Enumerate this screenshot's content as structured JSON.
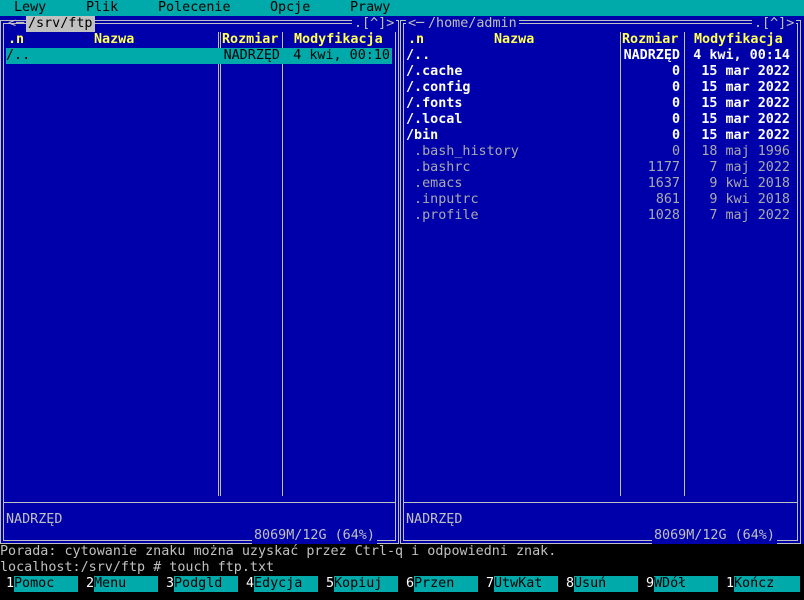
{
  "menubar": [
    "Lewy",
    "Plik",
    "Polecenie",
    "Opcje",
    "Prawy"
  ],
  "left_panel": {
    "path": " /srv/ftp ",
    "corner": ".[^]>",
    "arrows": "<─",
    "columns": [
      ".n",
      "Nazwa",
      "Rozmiar",
      "Modyfikacja"
    ],
    "rows": [
      {
        "name": "/..",
        "size": "NADRZĘD",
        "date": "4 kwi, 00:10",
        "selected": true,
        "type": "dir"
      }
    ],
    "status": "NADRZĘD",
    "free": " 8069M/12G (64%) "
  },
  "right_panel": {
    "path": " /home/admin ",
    "corner": ".[^]>",
    "arrows": "<─",
    "columns": [
      ".n",
      "Nazwa",
      "Rozmiar",
      "Modyfikacja"
    ],
    "rows": [
      {
        "name": "/..",
        "size": "NADRZĘD",
        "date": "4 kwi, 00:14",
        "type": "dir"
      },
      {
        "name": "/.cache",
        "size": "0",
        "date": "15 mar 2022",
        "type": "dir"
      },
      {
        "name": "/.config",
        "size": "0",
        "date": "15 mar 2022",
        "type": "dir"
      },
      {
        "name": "/.fonts",
        "size": "0",
        "date": "15 mar 2022",
        "type": "dir"
      },
      {
        "name": "/.local",
        "size": "0",
        "date": "15 mar 2022",
        "type": "dir"
      },
      {
        "name": "/bin",
        "size": "0",
        "date": "15 mar 2022",
        "type": "dir"
      },
      {
        "name": " .bash_history",
        "size": "0",
        "date": "18 maj 1996",
        "type": "file"
      },
      {
        "name": " .bashrc",
        "size": "1177",
        "date": "7 maj 2022",
        "type": "file"
      },
      {
        "name": " .emacs",
        "size": "1637",
        "date": "9 kwi 2018",
        "type": "file"
      },
      {
        "name": " .inputrc",
        "size": "861",
        "date": "9 kwi 2018",
        "type": "file"
      },
      {
        "name": " .profile",
        "size": "1028",
        "date": "7 maj 2022",
        "type": "file"
      }
    ],
    "status": "NADRZĘD",
    "free": " 8069M/12G (64%) "
  },
  "hint": "Porada: cytowanie znaku można uzyskać przez Ctrl-q i odpowiedni znak.",
  "command_line": "localhost:/srv/ftp # touch ftp.txt",
  "fkeys": [
    {
      "num": "1",
      "label": "Pomoc"
    },
    {
      "num": "2",
      "label": "Menu"
    },
    {
      "num": "3",
      "label": "Podgld"
    },
    {
      "num": "4",
      "label": "Edycja"
    },
    {
      "num": "5",
      "label": "Kopiuj"
    },
    {
      "num": "6",
      "label": "Przen"
    },
    {
      "num": "7",
      "label": "UtwKat"
    },
    {
      "num": "8",
      "label": "Usuń"
    },
    {
      "num": "9",
      "label": "WDół"
    },
    {
      "num": "10",
      "label": "Kończ"
    }
  ],
  "colors": {
    "panel_bg": "#0000aa",
    "bar_bg": "#00aaaa",
    "header": "#ffff55"
  }
}
